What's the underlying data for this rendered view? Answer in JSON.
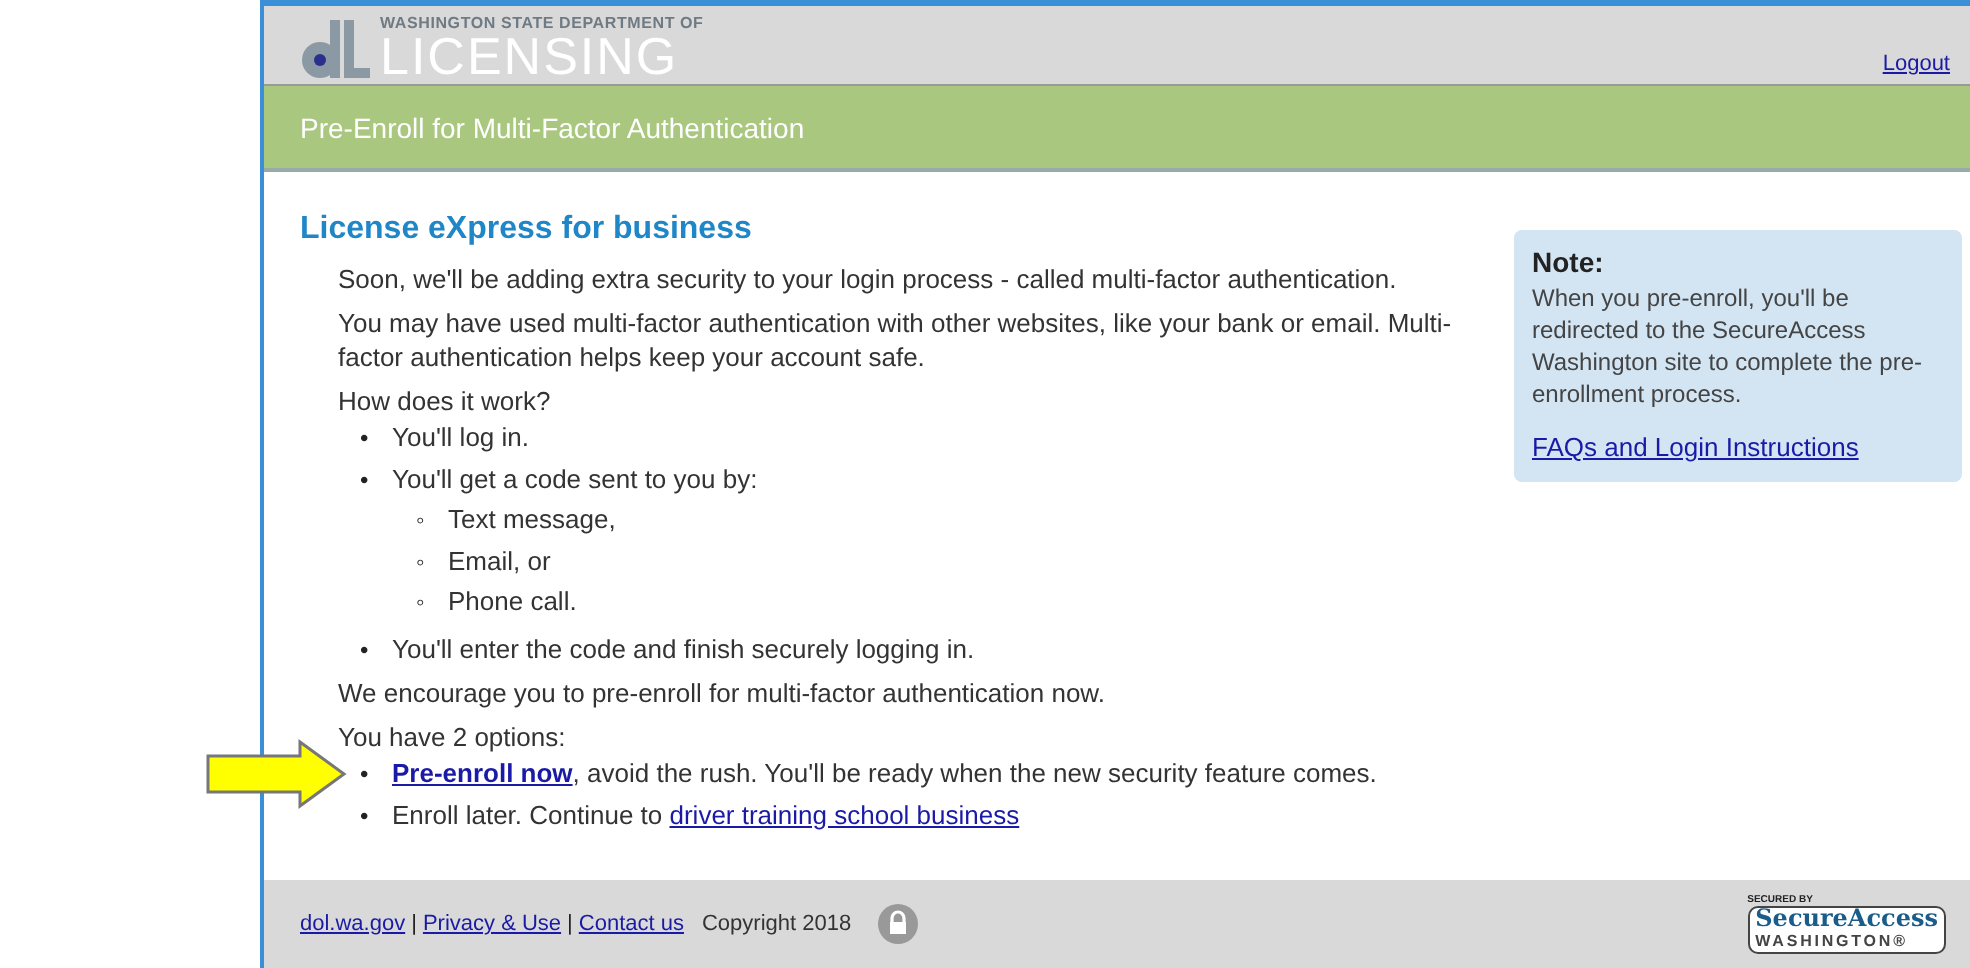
{
  "header": {
    "agency": "WASHINGTON STATE DEPARTMENT OF",
    "logo_text": "LICENSING",
    "logout": "Logout"
  },
  "banner": {
    "title": "Pre-Enroll for Multi-Factor Authentication"
  },
  "main": {
    "heading": "License eXpress for business",
    "paragraphs": [
      "Soon, we'll be adding extra security to your login process - called multi-factor authentication.",
      "You may have used multi-factor authentication with other websites, like your bank or email. Multi-factor authentication helps keep your account safe."
    ],
    "how_label": "How does it work?",
    "steps": [
      {
        "marker": "•",
        "text": "You'll log in."
      },
      {
        "marker": "•",
        "text": "You'll get a code sent to you by:",
        "children": [
          {
            "marker": "◦",
            "text": "Text message,"
          },
          {
            "marker": "◦",
            "text": "Email, or"
          },
          {
            "marker": "◦",
            "text": "Phone call."
          }
        ]
      },
      {
        "marker": "•",
        "text": "You'll enter the code and finish securely logging in."
      }
    ],
    "encourage": "We encourage you to pre-enroll for multi-factor authentication now.",
    "options_label": "You have 2 options:",
    "options": [
      {
        "marker": "•",
        "link": "Pre-enroll now",
        "bold": true,
        "after": ", avoid the rush. You'll be ready when the new security feature comes.",
        "arrow": true
      },
      {
        "marker": "•",
        "before": "Enroll later. Continue to ",
        "link": "driver training school business",
        "bold": false,
        "arrow": false
      }
    ]
  },
  "note": {
    "title": "Note:",
    "text": "When you pre-enroll, you'll be redirected to the SecureAccess Washington site to complete the pre-enrollment process.",
    "link": "FAQs and Login Instructions"
  },
  "footer": {
    "links": [
      "dol.wa.gov",
      "Privacy & Use",
      "Contact us"
    ],
    "separators": [
      "|",
      "|"
    ],
    "copyright": "Copyright 2018",
    "badge": {
      "caption": "SECURED BY",
      "name": "SecureAccess",
      "state": "WASHINGTON®"
    }
  }
}
